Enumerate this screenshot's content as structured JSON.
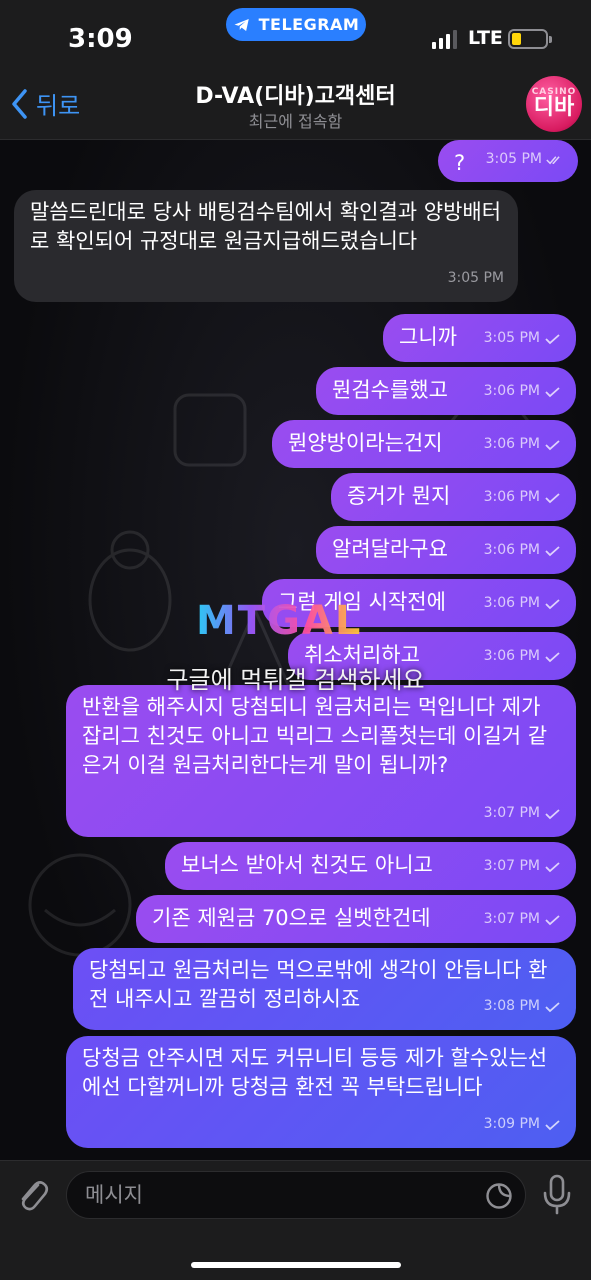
{
  "status_bar": {
    "time": "3:09",
    "app_pill": "TELEGRAM",
    "network": "LTE"
  },
  "header": {
    "back_label": "뒤로",
    "title": "D-VA(디바)고객센터",
    "subtitle": "최근에 접속함",
    "avatar_small": "CASINO",
    "avatar_big": "디바"
  },
  "messages": [
    {
      "dir": "out",
      "text": "?",
      "time": "3:05 PM",
      "status": "read"
    },
    {
      "dir": "in",
      "text": "말씀드린대로 당사 배팅검수팀에서 확인결과 양방배터로 확인되어 규정대로 원금지급해드렸습니다",
      "time": "3:05 PM"
    },
    {
      "dir": "out",
      "text": "그니까",
      "time": "3:05 PM",
      "status": "sent"
    },
    {
      "dir": "out",
      "text": "뭔검수를했고",
      "time": "3:06 PM",
      "status": "sent"
    },
    {
      "dir": "out",
      "text": "뭔양방이라는건지",
      "time": "3:06 PM",
      "status": "sent"
    },
    {
      "dir": "out",
      "text": "증거가 뭔지",
      "time": "3:06 PM",
      "status": "sent"
    },
    {
      "dir": "out",
      "text": "알려달라구요",
      "time": "3:06 PM",
      "status": "sent"
    },
    {
      "dir": "out",
      "text": "그럼 게임 시작전에",
      "time": "3:06 PM",
      "status": "sent"
    },
    {
      "dir": "out",
      "text": "취소처리하고",
      "time": "3:06 PM",
      "status": "sent"
    },
    {
      "dir": "out",
      "text": "반환을 해주시지 당첨되니 원금처리는 먹입니다 제가 잡리그 친것도 아니고 빅리그 스리폴첫는데 이길거 같은거 이걸 원금처리한다는게 말이 됩니까?",
      "time": "3:07 PM",
      "status": "sent"
    },
    {
      "dir": "out",
      "text": "보너스 받아서 친것도 아니고",
      "time": "3:07 PM",
      "status": "sent"
    },
    {
      "dir": "out",
      "text": "기존 제원금 70으로 실벳한건데",
      "time": "3:07 PM",
      "status": "sent"
    },
    {
      "dir": "out",
      "text": "당첨되고 원금처리는 먹으로밖에 생각이 안듭니다 환전 내주시고 깔끔히 정리하시죠",
      "time": "3:08 PM",
      "status": "sent"
    },
    {
      "dir": "out",
      "text": "당청금 안주시면 저도 커뮤니티 등등 제가 할수있는선에선 다할꺼니까 당청금 환전 꼭 부탁드립니다",
      "time": "3:09 PM",
      "status": "sent"
    }
  ],
  "watermark": {
    "logo": "MTGAL",
    "caption": "구글에 먹튀갤 검색하세요"
  },
  "input": {
    "placeholder": "메시지"
  },
  "colors": {
    "accent": "#3e94f4",
    "bubble_out_purple": "#9a4cf0",
    "bubble_out_blue": "#5a5cf3",
    "bubble_in": "#2a2a2e"
  }
}
